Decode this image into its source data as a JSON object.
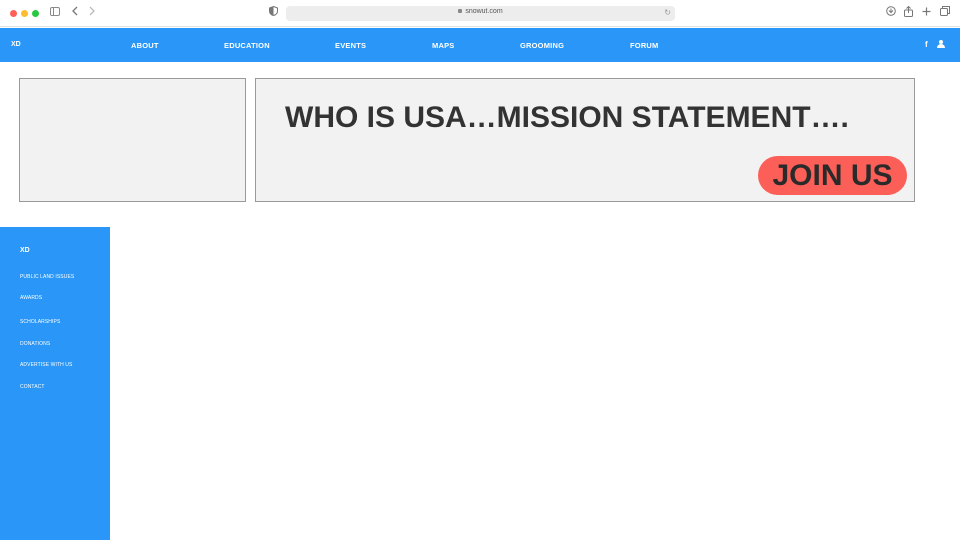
{
  "browser": {
    "url": "snowut.com",
    "colors": {
      "close": "#fe5f57",
      "minimize": "#febc2e",
      "zoom": "#28c840"
    },
    "icons": [
      "sidebar-toggle-icon",
      "back-icon",
      "forward-icon",
      "shield-icon",
      "lock-icon",
      "reload-icon",
      "download-icon",
      "share-icon",
      "new-tab-icon",
      "tabs-overview-icon"
    ]
  },
  "header": {
    "logo": "XD",
    "nav": [
      "ABOUT",
      "EDUCATION",
      "EVENTS",
      "MAPS",
      "GROOMING",
      "FORUM"
    ],
    "facebook": "f",
    "accent": "#2a96f7"
  },
  "hero": {
    "title": "WHO IS USA…MISSION STATEMENT….",
    "cta": "JOIN US",
    "cta_color": "#fc5f57"
  },
  "sidebar": {
    "logo": "XD",
    "items": [
      "PUBLIC LAND ISSUES",
      "AWARDS",
      "SCHOLARSHIPS",
      "DONATIONS",
      "ADVERTISE WITH US",
      "CONTACT"
    ]
  }
}
